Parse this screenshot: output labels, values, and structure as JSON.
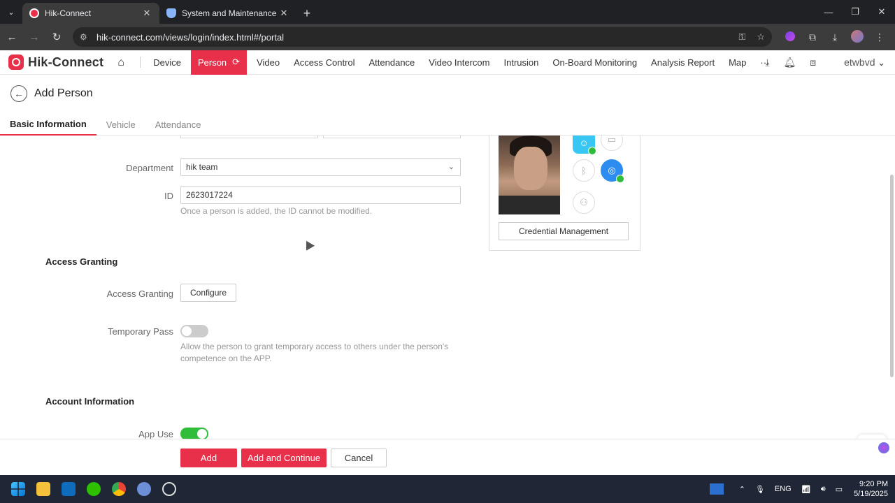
{
  "browser": {
    "tabs": [
      {
        "title": "Hik-Connect",
        "active": true
      },
      {
        "title": "System and Maintenance",
        "active": false
      }
    ],
    "url": "hik-connect.com/views/login/index.html#/portal"
  },
  "header": {
    "brand": "Hik-Connect",
    "nav": [
      "Device",
      "Person",
      "Video",
      "Access Control",
      "Attendance",
      "Video Intercom",
      "Intrusion",
      "On-Board Monitoring",
      "Analysis Report",
      "Map"
    ],
    "active_nav": "Person",
    "more": "···",
    "user": "etwbvd",
    "accent": "#e8304a"
  },
  "page": {
    "title": "Add Person",
    "subtabs": [
      "Basic Information",
      "Vehicle",
      "Attendance"
    ]
  },
  "form": {
    "department_label": "Department",
    "department_value": "hik team",
    "id_label": "ID",
    "id_value": "2623017224",
    "id_hint": "Once a person is added, the ID cannot be modified.",
    "access_section": "Access Granting",
    "access_label": "Access Granting",
    "configure_btn": "Configure",
    "temp_pass_label": "Temporary Pass",
    "temp_pass_on": false,
    "temp_pass_hint": "Allow the person to grant temporary access to others under the person's competence on the APP.",
    "account_section": "Account Information",
    "app_use_label": "App Use",
    "app_use_on": true
  },
  "credential": {
    "button": "Credential Management",
    "icons": [
      "face-icon",
      "card-icon",
      "bluetooth-icon",
      "fingerprint-icon",
      "person-icon"
    ]
  },
  "footer": {
    "add": "Add",
    "add_continue": "Add and Continue",
    "cancel": "Cancel"
  },
  "taskbar": {
    "lang": "ENG",
    "time": "9:20 PM",
    "date": "5/19/2025"
  }
}
